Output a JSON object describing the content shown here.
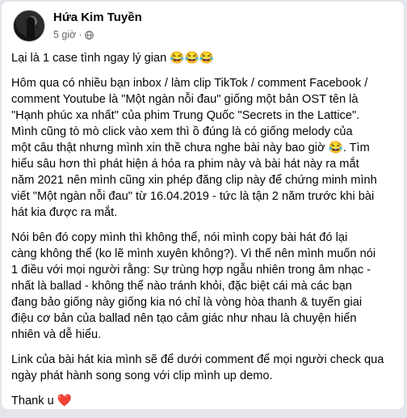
{
  "post": {
    "author": "Hứa Kim Tuyền",
    "time": "5 giờ",
    "separator": "·",
    "privacy_icon": "globe-icon",
    "paragraphs": [
      "Lại là 1 case tình ngay lý gian 😂😂😂",
      "Hôm qua có nhiều bạn inbox / làm clip TikTok / comment Facebook /\ncomment Youtube là \"Một ngàn nỗi đau\" giống một bản OST tên là\n\"Hạnh phúc xa nhất\" của phim Trung Quốc \"Secrets in the Lattice\".\nMình cũng tò mò click vào xem thì ồ đúng là có giống melody của\nmột câu thật nhưng mình xin thề chưa nghe bài này bao giờ 😂. Tìm\nhiểu sâu hơn thì phát hiện á hóa ra phim này và bài hát này ra mắt\nnăm 2021 nên mình cũng xin phép đăng clip này để chứng minh mình\nviết \"Một ngàn nỗi đau\" từ 16.04.2019 - tức là tận 2 năm trước khi bài\nhát kia được ra mắt.",
      "Nói bên đó copy mình thì không thể, nói mình copy bài hát đó lại\ncàng không thể (ko lẽ mình xuyên không?). Vì thế nên mình muốn nói\n1 điều với mọi người rằng: Sự trùng hợp ngẫu nhiên trong âm nhạc -\nnhất là ballad - không thể nào tránh khỏi, đặc biệt cái mà các bạn\nđang bảo giống này giống kia nó chỉ là vòng hòa thanh & tuyến giai\nđiệu cơ bản của ballad nên tạo cảm giác như nhau là chuyện hiển\nnhiên và dễ hiểu.",
      "Link của bài hát kia mình sẽ để dưới comment để mọi người check qua\nngày phát hành song song với clip mình up demo.",
      "Thank u ❤️"
    ]
  }
}
